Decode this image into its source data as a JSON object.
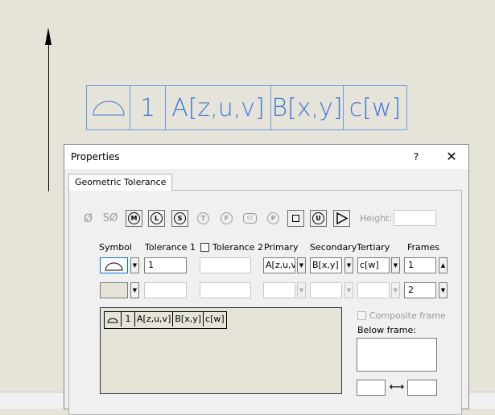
{
  "canvas": {
    "fcf_cells": [
      "⌓",
      "1",
      "A[z,u,v]",
      "B[x,y]",
      "c[w]"
    ]
  },
  "dialog": {
    "title": "Properties",
    "help": "?",
    "close": "✕",
    "tab": "Geometric Tolerance",
    "symbols": {
      "diameter": "Ø",
      "spherical_diameter": "SØ",
      "m": "M",
      "l": "L",
      "s": "S",
      "t": "T",
      "f": "F",
      "st": "ST",
      "p": "P",
      "u": "U"
    },
    "height_label": "Height:",
    "height_value": "",
    "headers": {
      "symbol": "Symbol",
      "tol1": "Tolerance 1",
      "tol2": "Tolerance 2",
      "primary": "Primary",
      "secondary": "Secondary",
      "tertiary": "Tertiary",
      "frames": "Frames"
    },
    "row1": {
      "tolerance1": "1",
      "tolerance2": "",
      "primary": "A[z,u,v",
      "secondary": "B[x,y]",
      "tertiary": "c[w]",
      "frames": "1"
    },
    "row2": {
      "tolerance1": "",
      "tolerance2": "",
      "primary": "",
      "secondary": "",
      "tertiary": "",
      "frames": "2"
    },
    "preview_cells": [
      "⌓",
      "1",
      "A[z,u,v]",
      "B[x,y]",
      "c[w]"
    ],
    "composite_label": "Composite frame",
    "below_frame_label": "Below frame:",
    "spacing_arrow": "⟷"
  },
  "colors": {
    "canvas_bg": "#e6e4d8",
    "annotation_blue": "#3c78dc"
  }
}
